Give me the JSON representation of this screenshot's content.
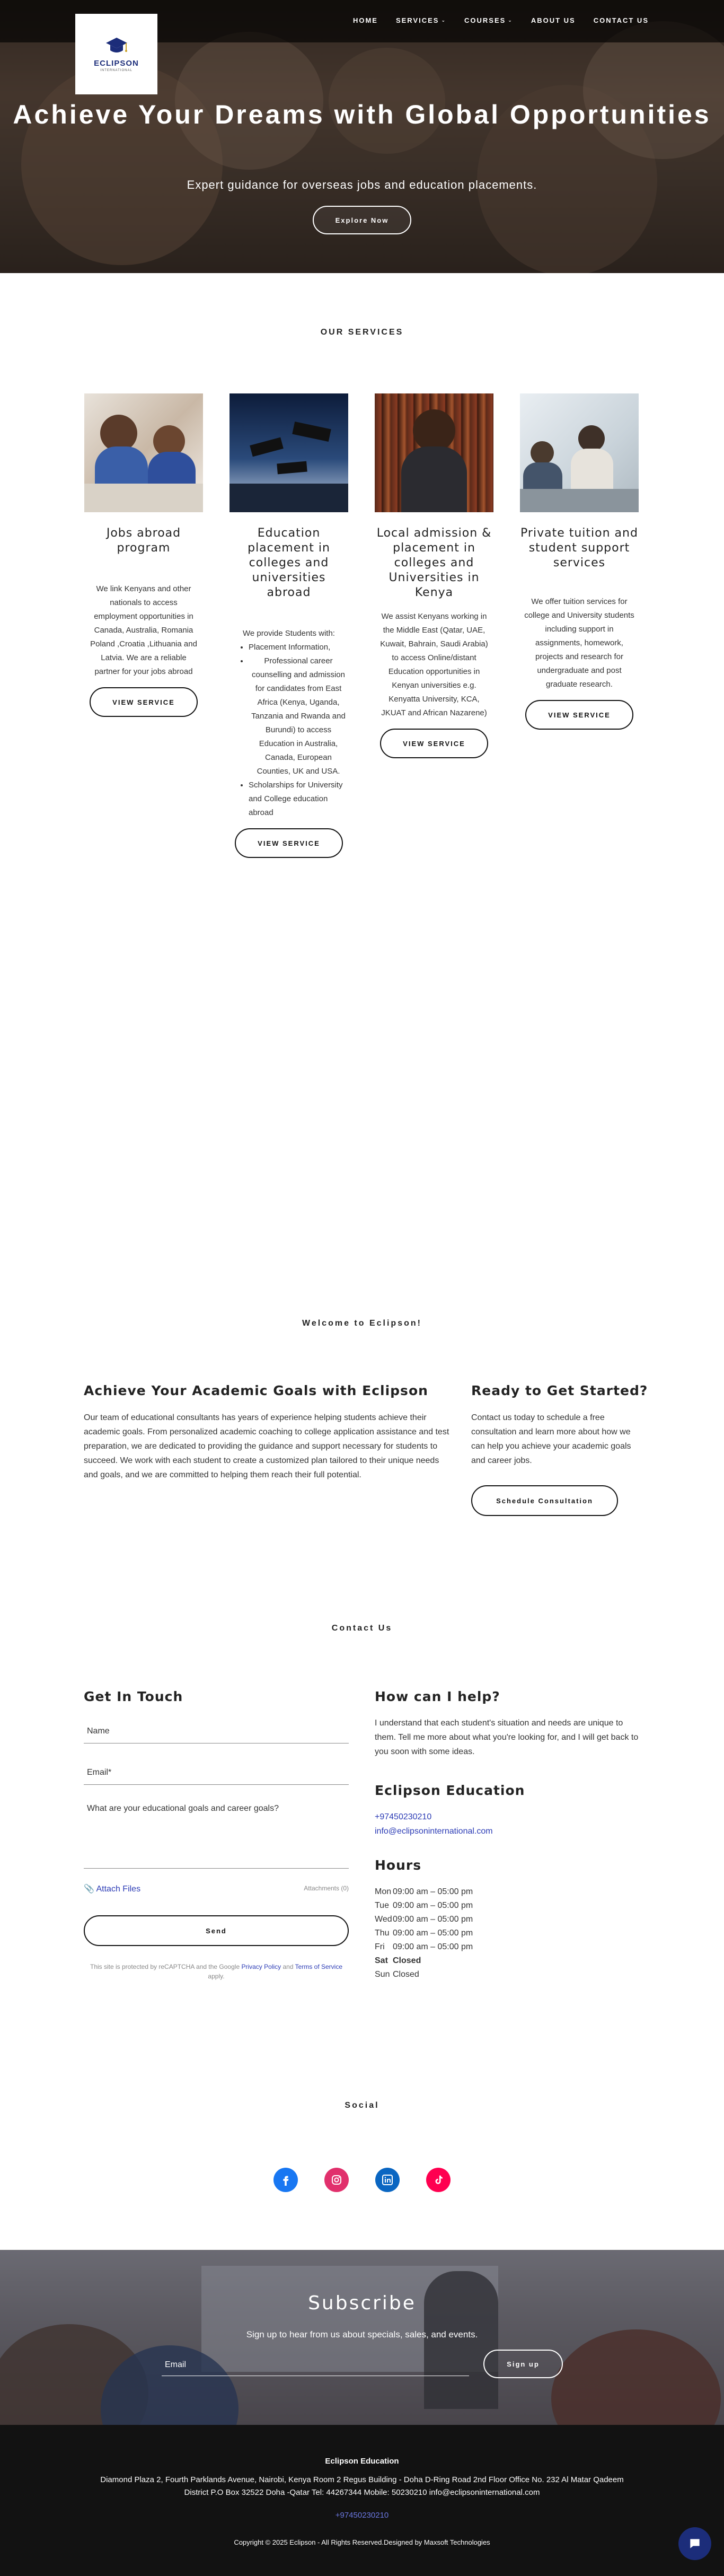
{
  "nav": {
    "items": [
      {
        "label": "HOME",
        "has_dropdown": false
      },
      {
        "label": "SERVICES",
        "has_dropdown": true
      },
      {
        "label": "COURSES",
        "has_dropdown": true
      },
      {
        "label": "ABOUT US",
        "has_dropdown": false
      },
      {
        "label": "CONTACT US",
        "has_dropdown": false
      }
    ]
  },
  "logo": {
    "text": "ECLIPSON",
    "tagline": "INTERNATIONAL"
  },
  "hero": {
    "title": "Achieve Your Dreams with Global Opportunities",
    "subtitle": "Expert guidance for overseas jobs and education placements.",
    "button": "Explore Now"
  },
  "services": {
    "title": "OUR SERVICES",
    "items": [
      {
        "title": "Jobs abroad program",
        "desc": "We link Kenyans and other nationals to access employment opportunities in Canada, Australia, Romania Poland ,Croatia ,Lithuania and Latvia. We are a reliable partner for your jobs abroad",
        "button": "VIEW SERVICE"
      },
      {
        "title": "Education placement in colleges and universities abroad",
        "intro": "We provide Students with:",
        "bullets": [
          "Placement Information,",
          "Professional career counselling and admission for candidates from East Africa (Kenya, Uganda, Tanzania and Rwanda and Burundi) to access Education in Australia, Canada, European Counties, UK and USA.",
          "Scholarships for University and College education abroad"
        ],
        "button": "VIEW SERVICE"
      },
      {
        "title": "Local admission & placement in colleges and Universities in Kenya",
        "desc": "We assist Kenyans working in the Middle East (Qatar, UAE, Kuwait, Bahrain, Saudi Arabia) to access Online/distant Education opportunities in Kenyan universities e.g. Kenyatta University, KCA, JKUAT and African Nazarene)",
        "button": "VIEW SERVICE"
      },
      {
        "title": "Private tuition and student support services",
        "desc": "We offer tuition services for college and University students including support in assignments, homework, projects and research for undergraduate and post graduate research.",
        "button": "VIEW SERVICE"
      }
    ]
  },
  "welcome": {
    "title": "Welcome to Eclipson!",
    "heading": "Achieve Your Academic Goals with Eclipson",
    "text": "Our team of educational consultants has years of experience helping students achieve their academic goals. From personalized academic coaching to college application assistance and test preparation, we are dedicated to providing the guidance and support necessary for students to succeed. We work with each student to create a customized plan tailored to their unique needs and goals, and we are committed to helping them reach their full potential.",
    "cta_heading": "Ready to Get Started?",
    "cta_text": "Contact us today to schedule a free consultation and learn more about how we can help you achieve your academic goals and career jobs.",
    "cta_button": "Schedule Consultation"
  },
  "contact": {
    "title": "Contact Us",
    "form_heading": "Get In Touch",
    "name_placeholder": "Name",
    "email_placeholder": "Email*",
    "message_placeholder": "What are your educational goals and career goals?",
    "attach_label": "Attach Files",
    "attachments_label": "Attachments (0)",
    "send_button": "Send",
    "recaptcha_prefix": "This site is protected by reCAPTCHA and the Google",
    "privacy_link": "Privacy Policy",
    "and_text": "and",
    "terms_link": "Terms of Service",
    "apply_text": "apply.",
    "help_heading": "How can I help?",
    "help_text": "I understand that each student's situation and needs are unique to them. Tell me more about what you're looking for, and I will get back to you soon with some ideas.",
    "company_heading": "Eclipson Education",
    "phone": "+97450230210",
    "email": "info@eclipsoninternational.com",
    "hours_heading": "Hours",
    "hours": [
      {
        "day": "Mon",
        "time": "09:00 am – 05:00 pm",
        "bold": false
      },
      {
        "day": "Tue",
        "time": "09:00 am – 05:00 pm",
        "bold": false
      },
      {
        "day": "Wed",
        "time": "09:00 am – 05:00 pm",
        "bold": false
      },
      {
        "day": "Thu",
        "time": "09:00 am – 05:00 pm",
        "bold": false
      },
      {
        "day": "Fri",
        "time": "09:00 am – 05:00 pm",
        "bold": false
      },
      {
        "day": "Sat",
        "time": "Closed",
        "bold": true
      },
      {
        "day": "Sun",
        "time": "Closed",
        "bold": false
      }
    ]
  },
  "social": {
    "title": "Social",
    "icons": [
      "facebook-icon",
      "instagram-icon",
      "linkedin-icon",
      "tiktok-icon"
    ]
  },
  "subscribe": {
    "title": "Subscribe",
    "text": "Sign up to hear from us about specials, sales, and events.",
    "email_placeholder": "Email",
    "button": "Sign up"
  },
  "footer": {
    "company": "Eclipson Education",
    "address_line1": "Diamond Plaza 2, Fourth Parklands Avenue, Nairobi, Kenya Room 2 Regus Building - Doha D-Ring Road 2nd Floor Office No. 232 Al Matar Qadeem",
    "address_line2": "District P.O Box 32522 Doha -Qatar Tel: 44267344 Mobile: 50230210 info@eclipsoninternational.com",
    "phone": "+97450230210",
    "copyright": "Copyright © 2025 Eclipson - All Rights Reserved.Designed by Maxsoft Technologies"
  },
  "colors": {
    "brand": "#1c2d7a",
    "link": "#2b3bb5",
    "text": "#333333",
    "footer_bg": "#121212"
  }
}
